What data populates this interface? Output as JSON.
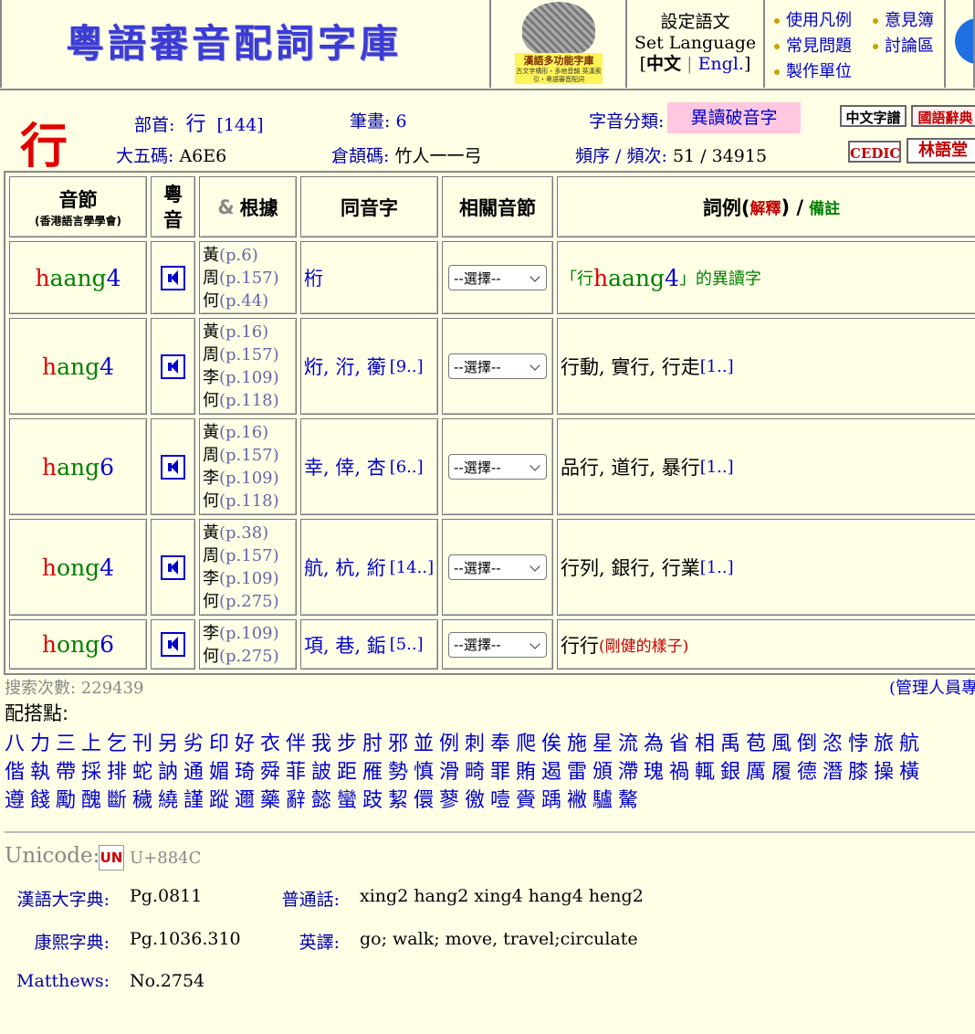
{
  "header": {
    "site_title": "粵語審音配詞字庫",
    "logo_caption1": "漢語多功能字庫",
    "logo_caption2": "古文字構形・多地音韻 英漢索引・粵語審音配詞",
    "lang_title": "設定語文",
    "lang_sub": "Set Language",
    "lang_zh": "中文",
    "lang_sep": "|",
    "lang_en": "Engl.",
    "lang_open": "[",
    "lang_close": "]",
    "links": [
      "使用凡例",
      "意見簿",
      "常見問題",
      "討論區",
      "製作單位"
    ]
  },
  "char": {
    "glyph": "行",
    "radical_label": "部首:",
    "radical_value": "行",
    "radical_num": "[144]",
    "strokes_label": "筆畫:",
    "strokes_value": "6",
    "class_label": "字音分類:",
    "class_value": "異讀破音字",
    "big5_label": "大五碼:",
    "big5_value": "A6E6",
    "cangjie_label": "倉頡碼:",
    "cangjie_value": "竹人一一弓",
    "freq_label": "頻序 / 頻次:",
    "freq_value": "51 / 34915",
    "refs": [
      "中文字譜",
      "國語辭典",
      "CEDICT",
      "林語堂"
    ]
  },
  "table": {
    "headers": {
      "syllable": "音節",
      "syllable_sub": "(香港語言學學會)",
      "sound": "粵音",
      "source_amp": "&",
      "source": "根據",
      "homophones": "同音字",
      "related": "相關音節",
      "examples": "詞例(",
      "examples_expl": "解釋",
      "examples_mid": ") /",
      "examples_note": "備註"
    },
    "rows": [
      {
        "initial": "h",
        "final": "aang",
        "tone": "4",
        "sources": [
          [
            "黃",
            "(p.6)"
          ],
          [
            "周",
            "(p.157)"
          ],
          [
            "何",
            "(p.44)"
          ]
        ],
        "homophones": "桁",
        "homophones_more": "",
        "select": "--選擇--",
        "ex_open": "「行",
        "ex_ini": "h",
        "ex_fin": "aang",
        "ex_tone": "4",
        "ex_close": "」的異讀字",
        "examples": "",
        "examples_more": "",
        "expl": ""
      },
      {
        "initial": "h",
        "final": "ang",
        "tone": "4",
        "sources": [
          [
            "黃",
            "(p.16)"
          ],
          [
            "周",
            "(p.157)"
          ],
          [
            "李",
            "(p.109)"
          ],
          [
            "何",
            "(p.118)"
          ]
        ],
        "homophones": "烆, 洐, 蘅",
        "homophones_more": "[9..]",
        "select": "--選擇--",
        "examples": "行動, 實行, 行走",
        "examples_more": "[1..]",
        "expl": ""
      },
      {
        "initial": "h",
        "final": "ang",
        "tone": "6",
        "sources": [
          [
            "黃",
            "(p.16)"
          ],
          [
            "周",
            "(p.157)"
          ],
          [
            "李",
            "(p.109)"
          ],
          [
            "何",
            "(p.118)"
          ]
        ],
        "homophones": "幸, 倖, 杏",
        "homophones_more": "[6..]",
        "select": "--選擇--",
        "examples": "品行, 道行, 暴行",
        "examples_more": "[1..]",
        "expl": ""
      },
      {
        "initial": "h",
        "final": "ong",
        "tone": "4",
        "sources": [
          [
            "黃",
            "(p.38)"
          ],
          [
            "周",
            "(p.157)"
          ],
          [
            "李",
            "(p.109)"
          ],
          [
            "何",
            "(p.275)"
          ]
        ],
        "homophones": "航, 杭, 絎",
        "homophones_more": "[14..]",
        "select": "--選擇--",
        "examples": "行列, 銀行, 行業",
        "examples_more": "[1..]",
        "expl": ""
      },
      {
        "initial": "h",
        "final": "ong",
        "tone": "6",
        "sources": [
          [
            "李",
            "(p.109)"
          ],
          [
            "何",
            "(p.275)"
          ]
        ],
        "homophones": "項, 巷, 銗",
        "homophones_more": "[5..]",
        "select": "--選擇--",
        "examples": "行行",
        "examples_more": "",
        "expl": "(剛健的樣子)"
      }
    ]
  },
  "footer": {
    "search_count": "搜索次數: 229439",
    "admin": "(管理人員專",
    "colloc_label": "配搭點:",
    "colloc_rows": [
      "八力三上乞刊另劣印好衣伴我步肘邪並例刺奉爬俟施星流為省相禹苞風倒恣悖旅航",
      "偕執帶採排蛇訥通媚琦舜菲詖距雁勢慎滑畸罪賄遏雷頒滯瑰禍輒銀厲履德潛膝操橫",
      "遵餞勵醜斷穢繞謹蹤邇藥辭懿蠻跂絜儇蓼徼噎賫踽襒驢驁"
    ],
    "unicode_label": "Unicode:",
    "unicode_logo": "UN",
    "unicode_value": "U+884C",
    "meta": [
      {
        "label": "漢語大字典:",
        "value": "Pg.0811"
      },
      {
        "label": "普通話:",
        "value": "xing2 hang2 xing4 hang4 heng2"
      },
      {
        "label": "康熙字典:",
        "value": "Pg.1036.310"
      },
      {
        "label": "英譯:",
        "value": "go; walk; move, travel;circulate"
      },
      {
        "label": "Matthews:",
        "value": "No.2754"
      }
    ]
  },
  "colors": {
    "background": "#FFFFE6",
    "initial": "#E00000",
    "final": "#008000",
    "tone": "#0000CC",
    "badge": "#FFC8E0"
  }
}
